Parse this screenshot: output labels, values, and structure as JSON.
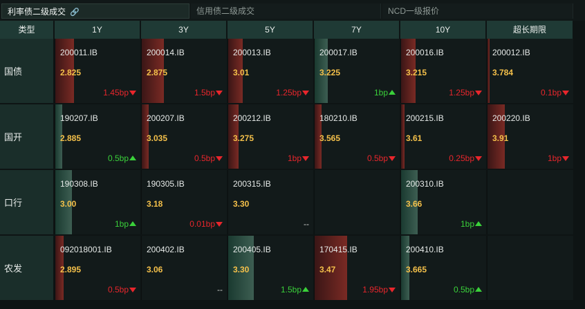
{
  "tabs": [
    {
      "label": "利率债二级成交",
      "active": true
    },
    {
      "label": "信用债二级成交",
      "active": false
    },
    {
      "label": "NCD一级报价",
      "active": false
    }
  ],
  "columns": [
    "类型",
    "1Y",
    "3Y",
    "5Y",
    "7Y",
    "10Y",
    "超长期限"
  ],
  "rows": [
    {
      "label": "国债",
      "cells": [
        {
          "code": "200011.IB",
          "yield": "2.825",
          "change": "1.45bp",
          "dir": "down",
          "bar": 0.22,
          "bar_color": "red"
        },
        {
          "code": "200014.IB",
          "yield": "2.875",
          "change": "1.5bp",
          "dir": "down",
          "bar": 0.26,
          "bar_color": "red"
        },
        {
          "code": "200013.IB",
          "yield": "3.01",
          "change": "1.25bp",
          "dir": "down",
          "bar": 0.17,
          "bar_color": "red"
        },
        {
          "code": "200017.IB",
          "yield": "3.225",
          "change": "1bp",
          "dir": "up",
          "bar": 0.15,
          "bar_color": "green"
        },
        {
          "code": "200016.IB",
          "yield": "3.215",
          "change": "1.25bp",
          "dir": "down",
          "bar": 0.17,
          "bar_color": "red"
        },
        {
          "code": "200012.IB",
          "yield": "3.784",
          "change": "0.1bp",
          "dir": "down",
          "bar": 0.02,
          "bar_color": "red"
        }
      ]
    },
    {
      "label": "国开",
      "cells": [
        {
          "code": "190207.IB",
          "yield": "2.885",
          "change": "0.5bp",
          "dir": "up",
          "bar": 0.08,
          "bar_color": "green"
        },
        {
          "code": "200207.IB",
          "yield": "3.035",
          "change": "0.5bp",
          "dir": "down",
          "bar": 0.08,
          "bar_color": "red"
        },
        {
          "code": "200212.IB",
          "yield": "3.275",
          "change": "1bp",
          "dir": "down",
          "bar": 0.12,
          "bar_color": "red"
        },
        {
          "code": "180210.IB",
          "yield": "3.565",
          "change": "0.5bp",
          "dir": "down",
          "bar": 0.08,
          "bar_color": "red"
        },
        {
          "code": "200215.IB",
          "yield": "3.61",
          "change": "0.25bp",
          "dir": "down",
          "bar": 0.04,
          "bar_color": "red"
        },
        {
          "code": "200220.IB",
          "yield": "3.91",
          "change": "1bp",
          "dir": "down",
          "bar": 0.2,
          "bar_color": "red"
        }
      ]
    },
    {
      "label": "口行",
      "cells": [
        {
          "code": "190308.IB",
          "yield": "3.00",
          "change": "1bp",
          "dir": "up",
          "bar": 0.19,
          "bar_color": "green"
        },
        {
          "code": "190305.IB",
          "yield": "3.18",
          "change": "0.01bp",
          "dir": "down",
          "bar": 0.0,
          "bar_color": "red"
        },
        {
          "code": "200315.IB",
          "yield": "3.30",
          "change": "--",
          "dir": "flat",
          "bar": 0.0,
          "bar_color": "red"
        },
        {
          "code": "",
          "yield": "",
          "change": "",
          "dir": "none",
          "bar": 0.0,
          "bar_color": "red"
        },
        {
          "code": "200310.IB",
          "yield": "3.66",
          "change": "1bp",
          "dir": "up",
          "bar": 0.19,
          "bar_color": "green"
        },
        {
          "code": "",
          "yield": "",
          "change": "",
          "dir": "none",
          "bar": 0.0,
          "bar_color": "red"
        }
      ]
    },
    {
      "label": "农发",
      "cells": [
        {
          "code": "092018001.IB",
          "yield": "2.895",
          "change": "0.5bp",
          "dir": "down",
          "bar": 0.1,
          "bar_color": "red"
        },
        {
          "code": "200402.IB",
          "yield": "3.06",
          "change": "--",
          "dir": "flat",
          "bar": 0.0,
          "bar_color": "red"
        },
        {
          "code": "200405.IB",
          "yield": "3.30",
          "change": "1.5bp",
          "dir": "up",
          "bar": 0.3,
          "bar_color": "green"
        },
        {
          "code": "170415.IB",
          "yield": "3.47",
          "change": "1.95bp",
          "dir": "down",
          "bar": 0.38,
          "bar_color": "red"
        },
        {
          "code": "200410.IB",
          "yield": "3.665",
          "change": "0.5bp",
          "dir": "up",
          "bar": 0.1,
          "bar_color": "green"
        },
        {
          "code": "",
          "yield": "",
          "change": "",
          "dir": "none",
          "bar": 0.0,
          "bar_color": "red"
        }
      ]
    }
  ],
  "colors": {
    "up": "#3ad13a",
    "down": "#e8262c",
    "yield": "#f4c04a",
    "header": "#1f3a35"
  }
}
